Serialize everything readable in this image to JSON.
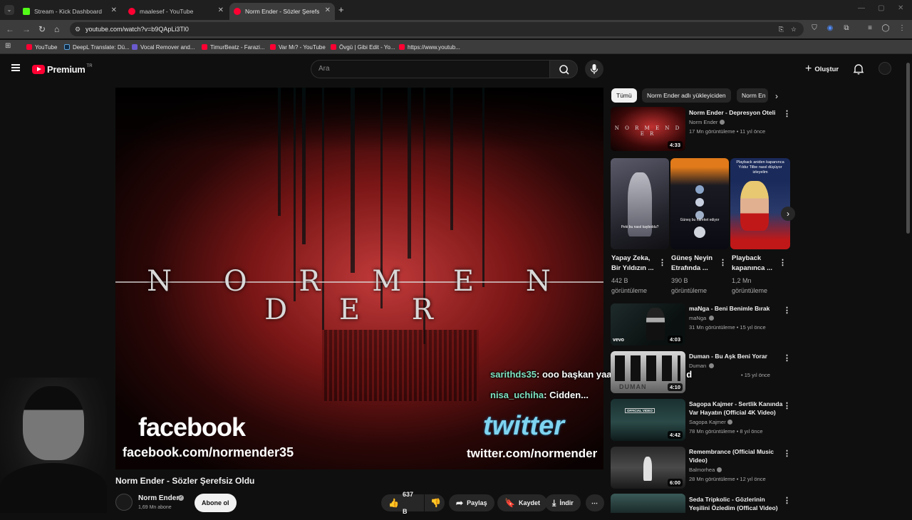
{
  "browser": {
    "tabs": [
      {
        "label": "Stream - Kick Dashboard",
        "color": "#53fc18"
      },
      {
        "label": "maalesef - YouTube",
        "color": "#ff0033"
      },
      {
        "label": "Norm Ender - Sözler Şerefsiz Ol",
        "color": "#ff0033"
      }
    ],
    "new_tab": "+",
    "url": "youtube.com/watch?v=b9QApLi3Tl0",
    "bookmarks": [
      {
        "label": "YouTube",
        "color": "#ff0033"
      },
      {
        "label": "DeepL Translate: Dü...",
        "color": "#0f2b46"
      },
      {
        "label": "Vocal Remover and...",
        "color": "#6a5acd"
      },
      {
        "label": "TimurBeatz - Farazi...",
        "color": "#ff0033"
      },
      {
        "label": "Var Mı? - YouTube",
        "color": "#ff0033"
      },
      {
        "label": "Övgü | Gibi Edit - Yo...",
        "color": "#ff0033"
      },
      {
        "label": "https://www.youtub...",
        "color": "#ff0033"
      }
    ]
  },
  "header": {
    "logo": "Premium",
    "logo_badge": "TR",
    "search_placeholder": "Ara",
    "create_label": "Oluştur"
  },
  "video": {
    "overlay_logo": "N O R M E N D E R",
    "facebook_label": "facebook",
    "facebook_url": "facebook.com/normender35",
    "twitter_label": "twitter",
    "twitter_url": "twitter.com/normender",
    "title": "Norm Ender - Sözler Şerefsiz Oldu",
    "channel": "Norm Ender",
    "subscribers": "1,69 Mn abone",
    "subscribe_label": "Abone ol",
    "likes": "637 B",
    "share_label": "Paylaş",
    "save_label": "Kaydet",
    "download_label": "İndir"
  },
  "chat": [
    {
      "user": "sarithds35",
      "message": ": ooo başkan yaa açtı adam adam d"
    },
    {
      "user": "nisa_uchiha",
      "message": ": Cidden..."
    }
  ],
  "sidebar": {
    "chips": [
      "Tümü",
      "Norm Ender adlı yükleyiciden",
      "Norm En"
    ],
    "videos": [
      {
        "title": "Norm Ender - Depresyon Oteli",
        "title2": "",
        "channel": "Norm Ender",
        "meta": "17 Mn görüntüleme • 11 yıl önce",
        "duration": "4:33"
      },
      {
        "title": "maNga - Beni Benimle Bırak",
        "title2": "",
        "channel": "maNga",
        "meta": "31 Mn görüntüleme • 15 yıl önce",
        "duration": "4:03"
      },
      {
        "title": "Duman - Bu Aşk Beni Yorar",
        "title2": "",
        "channel": "Duman",
        "meta": "• 15 yıl önce",
        "duration": "4:10"
      },
      {
        "title": "Sagopa Kajmer - Sertlik Kanında",
        "title2": "Var Hayatın (Official 4K Video)",
        "channel": "Sagopa Kajmer",
        "meta": "78 Mn görüntüleme • 8 yıl önce",
        "duration": "4:42"
      },
      {
        "title": "Remembrance (Official Music",
        "title2": "Video)",
        "channel": "Balmorhea",
        "meta": "28 Mn görüntüleme • 12 yıl önce",
        "duration": "6:00"
      },
      {
        "title": "Seda Tripkolic - Gözlerinin",
        "title2": "Yeşilini Özledim (Offical Video)",
        "channel": "",
        "meta": "",
        "duration": ""
      }
    ],
    "shorts": [
      {
        "title1": "Yapay Zeka,",
        "title2": "Bir Yıldızın ...",
        "views1": "442 B",
        "views2": "görüntüleme",
        "caption": "Peki bu nasıl kayboldu?"
      },
      {
        "title1": "Güneş Neyin",
        "title2": "Etrafında ...",
        "views1": "390 B",
        "views2": "görüntüleme",
        "caption": "Güneş bu hareket ediyor"
      },
      {
        "title1": "Playback",
        "title2": "kapanınca ...",
        "views1": "1,2 Mn",
        "views2": "görüntüleme",
        "caption": "Playback aniden kapanınca Yıldız Tilbe nasıl düşüyor izleyelim"
      }
    ],
    "vevo_label": "vevo",
    "duman_label": "DUMAN",
    "official_label": "OFFICIAL VIDEO"
  }
}
